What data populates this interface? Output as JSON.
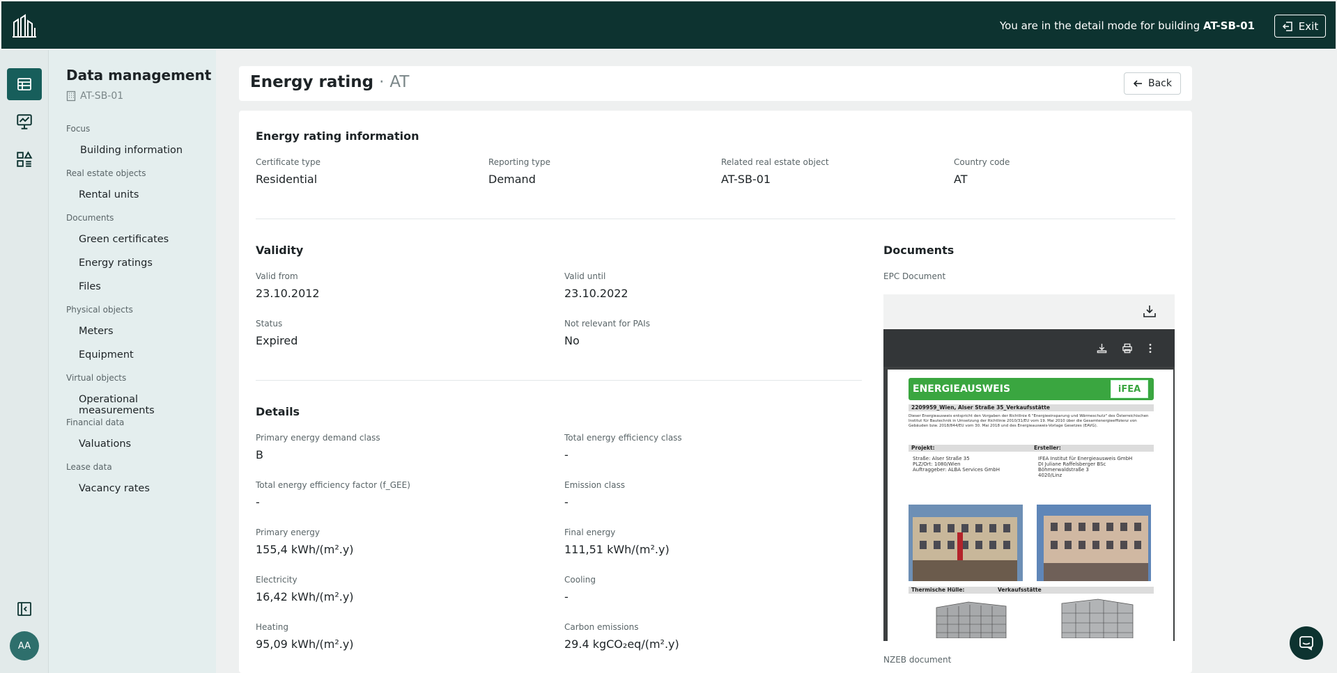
{
  "topbar": {
    "message_prefix": "You are in the detail mode for building",
    "building_id": "AT-SB-01",
    "exit_label": "Exit"
  },
  "rail": {
    "icons": [
      "table-icon",
      "monitor-chart-icon",
      "shapes-list-icon"
    ],
    "collapse_icon": "sidebar-collapse-icon",
    "avatar_initials": "AA"
  },
  "nav": {
    "title": "Data management",
    "building": "AT-SB-01",
    "sections": [
      {
        "label": "Focus",
        "items": [
          "Building information"
        ]
      },
      {
        "label": "Real estate objects",
        "items": [
          "Rental units"
        ]
      },
      {
        "label": "Documents",
        "items": [
          "Green certificates",
          "Energy ratings",
          "Files"
        ]
      },
      {
        "label": "Physical objects",
        "items": [
          "Meters",
          "Equipment"
        ]
      },
      {
        "label": "Virtual objects",
        "items": [
          "Operational measurements"
        ]
      },
      {
        "label": "Financial data",
        "items": [
          "Valuations"
        ]
      },
      {
        "label": "Lease data",
        "items": [
          "Vacancy rates"
        ]
      }
    ]
  },
  "header": {
    "title": "Energy rating",
    "separator": "·",
    "country": "AT",
    "back_label": "Back"
  },
  "info": {
    "title": "Energy rating information",
    "fields": [
      {
        "label": "Certificate type",
        "value": "Residential"
      },
      {
        "label": "Reporting type",
        "value": "Demand"
      },
      {
        "label": "Related real estate object",
        "value": "AT-SB-01"
      },
      {
        "label": "Country code",
        "value": "AT"
      }
    ]
  },
  "validity": {
    "title": "Validity",
    "fields": [
      {
        "label": "Valid from",
        "value": "23.10.2012"
      },
      {
        "label": "Valid until",
        "value": "23.10.2022"
      },
      {
        "label": "Status",
        "value": "Expired"
      },
      {
        "label": "Not relevant for PAIs",
        "value": "No"
      }
    ]
  },
  "details": {
    "title": "Details",
    "fields": [
      {
        "label": "Primary energy demand class",
        "value": "B"
      },
      {
        "label": "Total energy efficiency class",
        "value": "-"
      },
      {
        "label": "Total energy efficiency factor (f_GEE)",
        "value": "-"
      },
      {
        "label": "Emission class",
        "value": "-"
      },
      {
        "label": "Primary energy",
        "value": "155,4 kWh/(m².y)"
      },
      {
        "label": "Final energy",
        "value": "111,51 kWh/(m².y)"
      },
      {
        "label": "Electricity",
        "value": "16,42 kWh/(m².y)"
      },
      {
        "label": "Cooling",
        "value": "-"
      },
      {
        "label": "Heating",
        "value": "95,09 kWh/(m².y)"
      },
      {
        "label": "Carbon emissions",
        "value": "29.4 kgCO₂eq/(m².y)"
      }
    ]
  },
  "documents": {
    "title": "Documents",
    "epc_label": "EPC Document",
    "nzeb_label": "NZEB document",
    "pdf": {
      "banner": "ENERGIEAUSWEIS",
      "logo": "iFEA",
      "heading": "2209959_Wien, Alser Straße 35_Verkaufsstätte",
      "intro": "Dieser Energieausweis entspricht den Vorgaben der Richtlinie 6 \"Energieeinsparung und Wärmeschutz\" des Österreichischen Institut für Bautechnik in Umsetzung der Richtlinie 2010/31/EU vom 19. Mai 2010 über die Gesamtenergieeffizienz von Gebäuden bzw. 2018/844/EU vom 30. Mai 2018 und des Energieausweis-Vorlage Gesetzes (EAVG).",
      "projekt_label": "Projekt:",
      "ersteller_label": "Ersteller:",
      "projekt_lines": [
        "Straße:        Alser Straße 35",
        "PLZ/Ort:        1080/Wien",
        "Auftraggeber:  ALBA Services GmbH"
      ],
      "ersteller_lines": [
        "IFEA Institut für Energieausweis GmbH",
        "DI Juliane Raffelsberger BSc",
        "Böhmerwaldstraße 3",
        "4020/Linz"
      ],
      "huelle_label": "Thermische Hülle:",
      "verkauf_label": "Verkaufsstätte"
    }
  }
}
